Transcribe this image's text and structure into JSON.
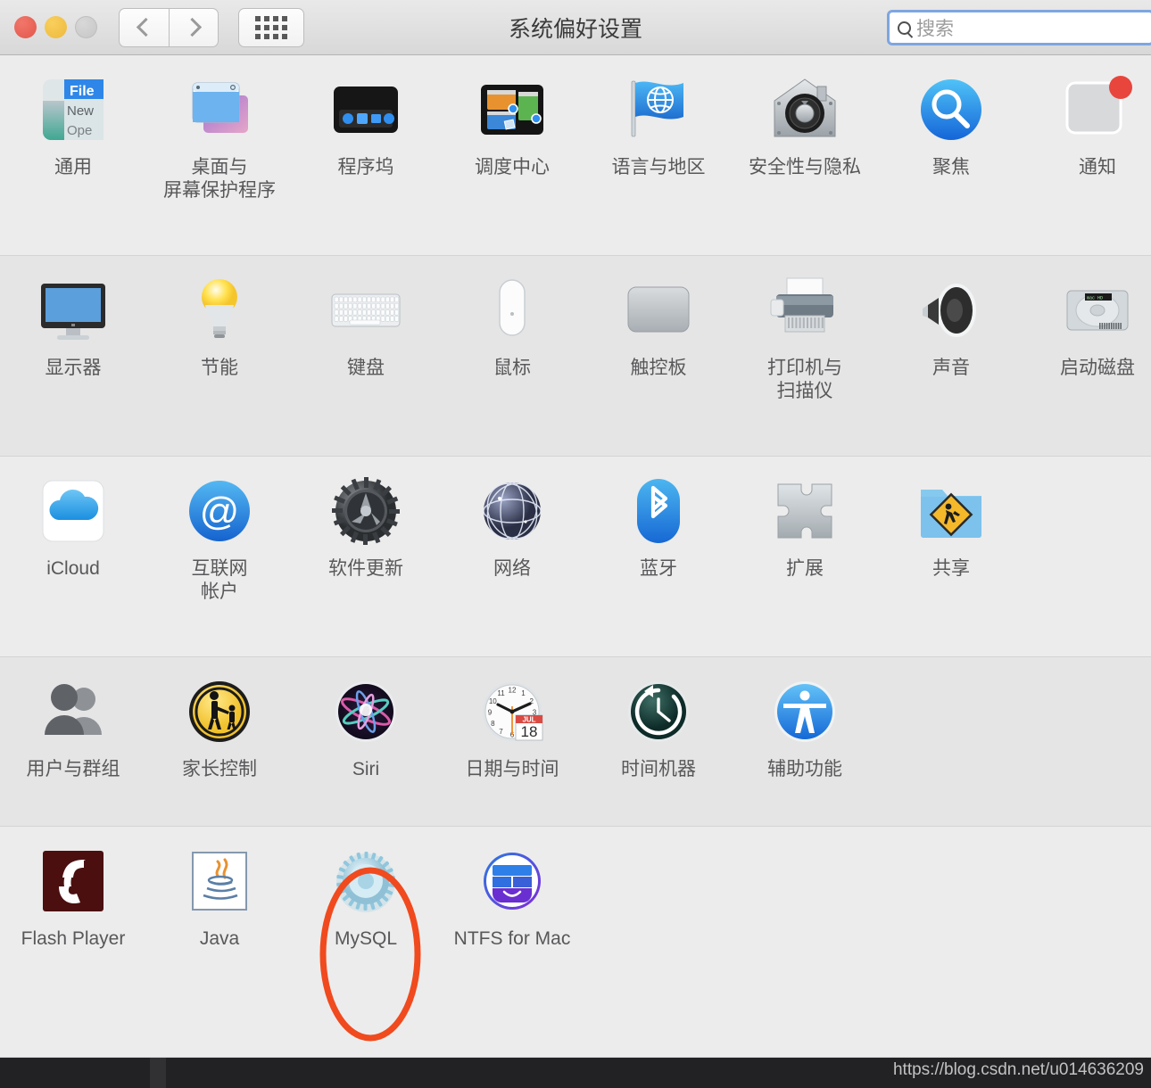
{
  "window": {
    "title": "系统偏好设置",
    "traffic_lights": [
      "close",
      "minimize",
      "zoom"
    ],
    "nav": {
      "back_icon": "chevron-left-icon",
      "forward_icon": "chevron-right-icon",
      "grid_icon": "grid-dots-icon"
    }
  },
  "search": {
    "placeholder": "搜索",
    "value": "",
    "icon": "search-icon",
    "focused": true
  },
  "annotation": {
    "shape": "ellipse",
    "color": "#f04a1e",
    "target_label": "MySQL"
  },
  "watermark": {
    "text": "https://blog.csdn.net/u014636209"
  },
  "colors": {
    "window_bg": "#ececec",
    "row_alt_bg": "#e5e5e5",
    "titlebar_bg": "#e2e2e2",
    "label_text": "#58585a",
    "search_border": "#7ea6e0",
    "annotation": "#f04a1e",
    "watermark_bar": "#222225"
  },
  "rows": [
    {
      "shade": "norm",
      "panes": [
        {
          "label": "通用",
          "icon": "general-icon"
        },
        {
          "label": "桌面与\n屏幕保护程序",
          "icon": "desktop-screensaver-icon"
        },
        {
          "label": "程序坞",
          "icon": "dock-icon"
        },
        {
          "label": "调度中心",
          "icon": "mission-control-icon"
        },
        {
          "label": "语言与地区",
          "icon": "language-region-flag-icon"
        },
        {
          "label": "安全性与隐私",
          "icon": "security-privacy-house-icon"
        },
        {
          "label": "聚焦",
          "icon": "spotlight-magnifier-icon"
        },
        {
          "label": "通知",
          "icon": "notifications-icon"
        }
      ]
    },
    {
      "shade": "alt",
      "panes": [
        {
          "label": "显示器",
          "icon": "displays-monitor-icon"
        },
        {
          "label": "节能",
          "icon": "energy-saver-bulb-icon"
        },
        {
          "label": "键盘",
          "icon": "keyboard-icon"
        },
        {
          "label": "鼠标",
          "icon": "mouse-icon"
        },
        {
          "label": "触控板",
          "icon": "trackpad-icon"
        },
        {
          "label": "打印机与\n扫描仪",
          "icon": "printers-scanners-icon"
        },
        {
          "label": "声音",
          "icon": "sound-speaker-icon"
        },
        {
          "label": "启动磁盘",
          "icon": "startup-disk-icon"
        }
      ]
    },
    {
      "shade": "norm",
      "panes": [
        {
          "label": "iCloud",
          "icon": "icloud-icon"
        },
        {
          "label": "互联网\n帐户",
          "icon": "internet-accounts-at-icon"
        },
        {
          "label": "软件更新",
          "icon": "software-update-gear-icon"
        },
        {
          "label": "网络",
          "icon": "network-globe-icon"
        },
        {
          "label": "蓝牙",
          "icon": "bluetooth-icon"
        },
        {
          "label": "扩展",
          "icon": "extensions-puzzle-icon"
        },
        {
          "label": "共享",
          "icon": "sharing-folder-icon"
        }
      ]
    },
    {
      "shade": "alt",
      "panes": [
        {
          "label": "用户与群组",
          "icon": "users-groups-icon"
        },
        {
          "label": "家长控制",
          "icon": "parental-controls-icon"
        },
        {
          "label": "Siri",
          "icon": "siri-icon"
        },
        {
          "label": "日期与时间",
          "icon": "date-time-clock-icon",
          "badge_month": "JUL",
          "badge_day": "18"
        },
        {
          "label": "时间机器",
          "icon": "time-machine-icon"
        },
        {
          "label": "辅助功能",
          "icon": "accessibility-icon"
        }
      ]
    },
    {
      "shade": "norm",
      "panes": [
        {
          "label": "Flash Player",
          "icon": "flash-player-icon"
        },
        {
          "label": "Java",
          "icon": "java-icon"
        },
        {
          "label": "MySQL",
          "icon": "mysql-gear-icon",
          "highlighted": true
        },
        {
          "label": "NTFS for Mac",
          "icon": "ntfs-for-mac-icon"
        }
      ]
    }
  ]
}
